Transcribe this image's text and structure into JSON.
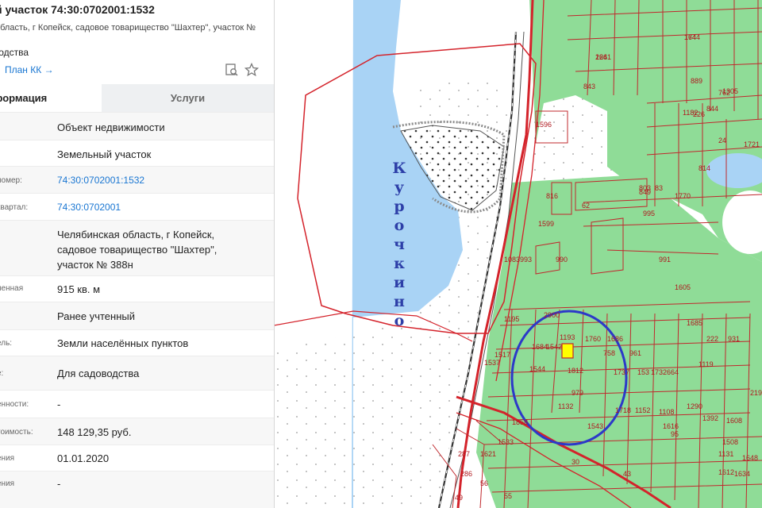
{
  "header": {
    "title": "й участок 74:30:0702001:1532",
    "subtitle": "область, г Копейск, садовое товарищество \"Шахтер\", участок №",
    "purpose_fragment": "водства",
    "plan_link": "План КК →",
    "icons": [
      "find-on-map-icon",
      "star-icon"
    ]
  },
  "tabs": [
    {
      "label": "формация",
      "active": true
    },
    {
      "label": "Услуги",
      "active": false
    }
  ],
  "rows": [
    {
      "label": "",
      "value": "Объект недвижимости",
      "link": false
    },
    {
      "label": "",
      "value": "Земельный участок",
      "link": false
    },
    {
      "label": "номер:",
      "value": "74:30:0702001:1532",
      "link": true
    },
    {
      "label": "квартал:",
      "value": "74:30:0702001",
      "link": true
    },
    {
      "label": "",
      "value": "Челябинская область, г Копейск, садовое товарищество \"Шахтер\", участок № 388н",
      "link": false
    },
    {
      "label": "ненная",
      "value": "915 кв. м",
      "link": false
    },
    {
      "label": "",
      "value": "Ранее учтенный",
      "link": false
    },
    {
      "label": "ель:",
      "value": "Земли населённых пунктов",
      "link": false
    },
    {
      "label": "е:",
      "value": "Для садоводства",
      "link": false
    },
    {
      "label": "енности:",
      "value": "-",
      "link": false
    },
    {
      "label": "тоимость:",
      "value": "148 129,35 руб.",
      "link": false
    },
    {
      "label": "ения",
      "value": "01.01.2020",
      "link": false
    },
    {
      "label": "ения",
      "value": "-",
      "link": false
    }
  ],
  "map": {
    "place_name": "Курочкино",
    "colors": {
      "water": "#a9d3f5",
      "green": "#8fdc97",
      "boundary": "#d4232b",
      "sand": "#f1f1f1",
      "highlight": "#ffff00",
      "circle": "#2c39c8"
    },
    "numbers": [
      "174",
      "226",
      "843",
      "889",
      "762",
      "1596",
      "1182",
      "844",
      "1305",
      "226",
      "24",
      "1721",
      "814",
      "803",
      "83",
      "849",
      "1770",
      "816",
      "62",
      "995",
      "1599",
      "1083",
      "993",
      "990",
      "991",
      "1605",
      "1195",
      "2900",
      "1685",
      "1193",
      "1760",
      "1686",
      "222",
      "931",
      "1517",
      "1684",
      "1542",
      "1537",
      "1544",
      "758",
      "961",
      "1119",
      "1812",
      "1737",
      "153",
      "1732",
      "664",
      "979",
      "2194",
      "1132",
      "1718",
      "1152",
      "1108",
      "1290",
      "1858",
      "1543",
      "1616",
      "1392",
      "1608",
      "1533",
      "1621",
      "287",
      "286",
      "56",
      "49",
      "55",
      "30",
      "43",
      "95",
      "1508",
      "1131",
      "1648",
      "1612",
      "1634",
      "1644",
      "1641"
    ]
  }
}
